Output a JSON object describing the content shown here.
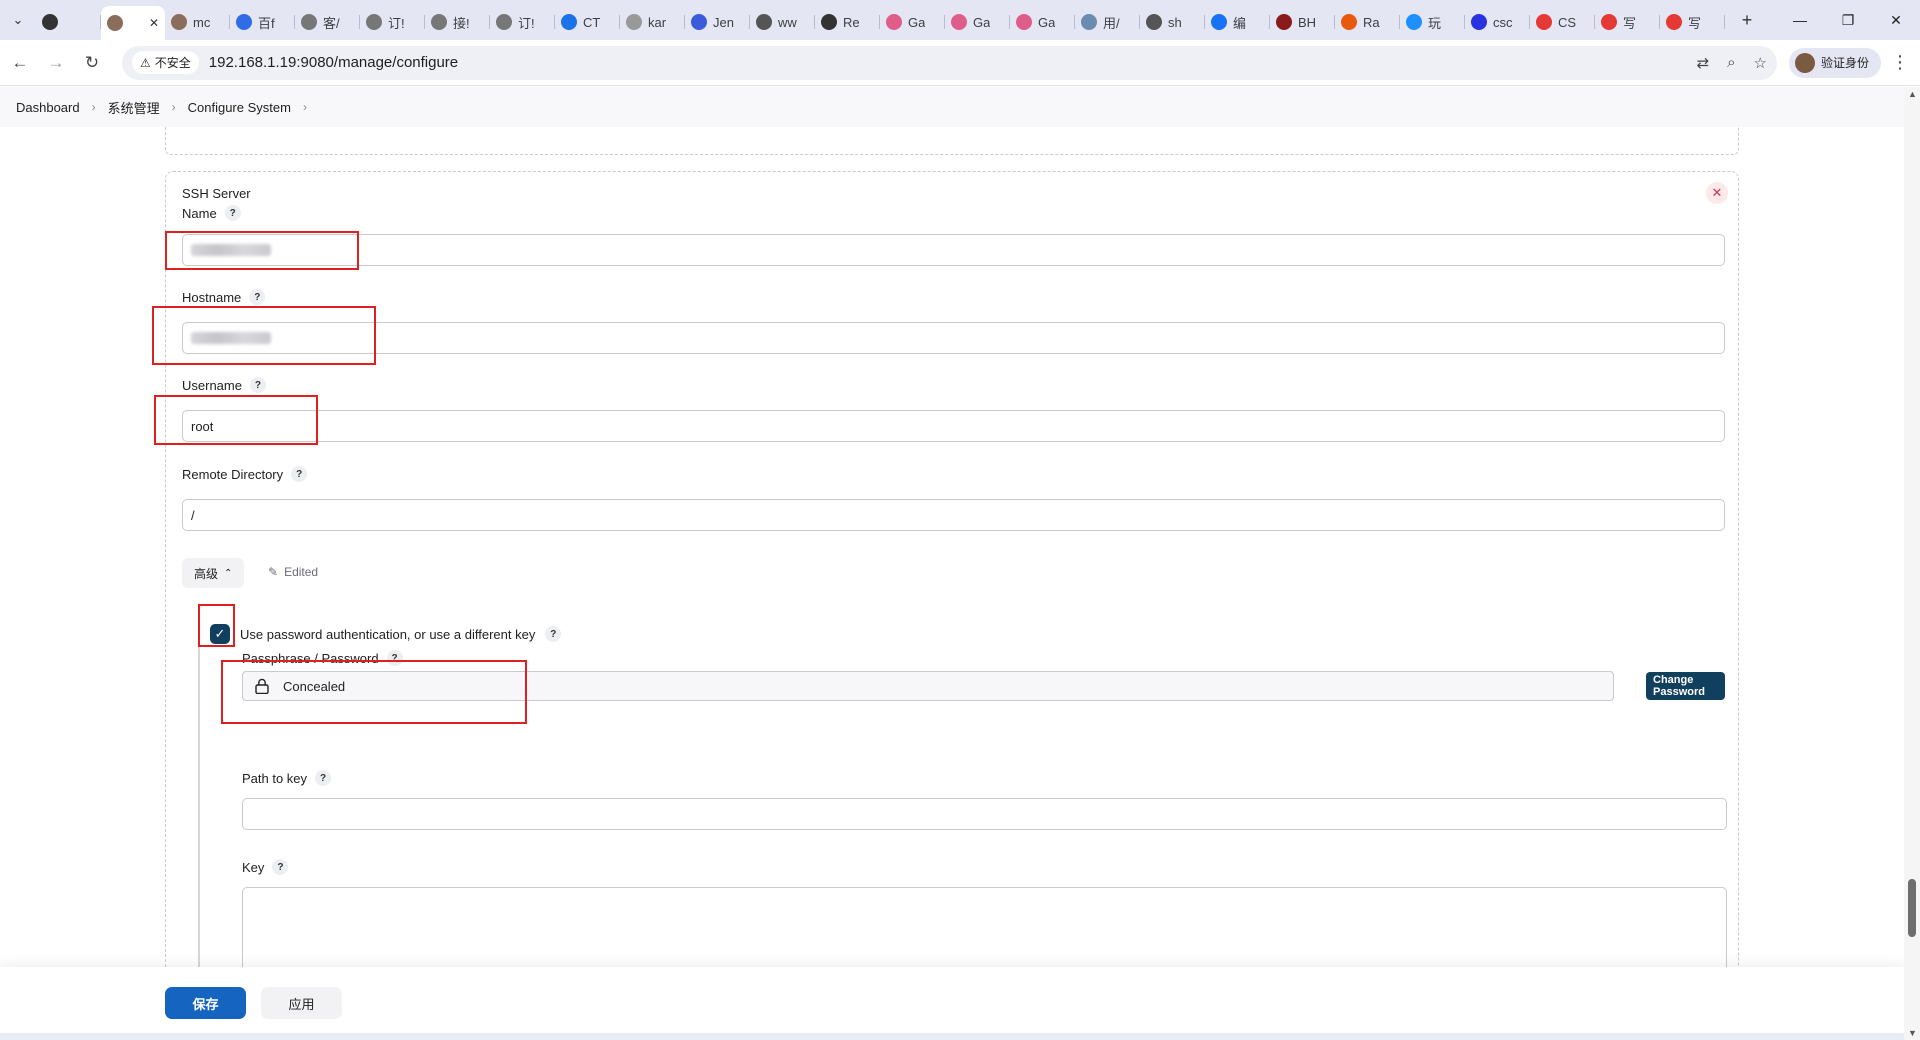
{
  "browser": {
    "tabs": [
      {
        "icon": "github-icon",
        "label": "",
        "color": "#333333"
      },
      {
        "icon": "jenkins-icon",
        "label": "",
        "color": "#8a6d5a",
        "active": true
      },
      {
        "icon": "jenkins-icon",
        "label": "mc",
        "color": "#8a6d5a"
      },
      {
        "icon": "baidu-doc-icon",
        "label": "百f",
        "color": "#2f6ce5"
      },
      {
        "icon": "script-icon",
        "label": "客/",
        "color": "#777777"
      },
      {
        "icon": "script-icon",
        "label": "订!",
        "color": "#777777"
      },
      {
        "icon": "script-icon",
        "label": "接!",
        "color": "#777777"
      },
      {
        "icon": "script-icon",
        "label": "订!",
        "color": "#777777"
      },
      {
        "icon": "ct-icon",
        "label": "CT",
        "color": "#1a73e8"
      },
      {
        "icon": "doc-icon",
        "label": "kar",
        "color": "#999999"
      },
      {
        "icon": "jenkins-blue-icon",
        "label": "Jen",
        "color": "#3b5bdb"
      },
      {
        "icon": "globe-icon",
        "label": "ww",
        "color": "#555555"
      },
      {
        "icon": "github-icon",
        "label": "Re",
        "color": "#333333"
      },
      {
        "icon": "gallery-icon",
        "label": "Ga",
        "color": "#e05d8a"
      },
      {
        "icon": "gallery-icon",
        "label": "Ga",
        "color": "#e05d8a"
      },
      {
        "icon": "gallery-icon",
        "label": "Ga",
        "color": "#e05d8a"
      },
      {
        "icon": "globe-icon",
        "label": "用/",
        "color": "#6a8caf"
      },
      {
        "icon": "globe-icon",
        "label": "sh",
        "color": "#555555"
      },
      {
        "icon": "zhihu-icon",
        "label": "编",
        "color": "#1772f6"
      },
      {
        "icon": "bh-icon",
        "label": "BH",
        "color": "#8b1a1a"
      },
      {
        "icon": "rai-icon",
        "label": "Ra",
        "color": "#e8590c"
      },
      {
        "icon": "sogou-icon",
        "label": "玩",
        "color": "#1e90ff"
      },
      {
        "icon": "baidu-icon",
        "label": "csc",
        "color": "#2932e1"
      },
      {
        "icon": "csdn-icon",
        "label": "CS",
        "color": "#e53935"
      },
      {
        "icon": "csdn-icon",
        "label": "写",
        "color": "#e53935"
      },
      {
        "icon": "csdn-icon",
        "label": "写",
        "color": "#e53935"
      }
    ],
    "security_label": "不安全",
    "url": "192.168.1.19:9080/manage/configure",
    "profile_label": "验证身份"
  },
  "breadcrumb": {
    "items": [
      "Dashboard",
      "系统管理",
      "Configure System"
    ]
  },
  "ssh_server": {
    "section_title": "SSH Server",
    "name_label": "Name",
    "hostname_label": "Hostname",
    "username_label": "Username",
    "username_value": "root",
    "remote_dir_label": "Remote Directory",
    "remote_dir_value": "/",
    "advanced_label": "高级",
    "edited_label": "Edited",
    "use_password_label": "Use password authentication, or use a different key",
    "passphrase_label": "Passphrase / Password",
    "passphrase_value": "Concealed",
    "change_password_label": "Change Password",
    "path_to_key_label": "Path to key",
    "key_label": "Key"
  },
  "actions": {
    "save_label": "保存",
    "apply_label": "应用"
  },
  "colors": {
    "primary": "#1565c0",
    "dark_button": "#11405e",
    "annotation_red": "#e02020"
  }
}
